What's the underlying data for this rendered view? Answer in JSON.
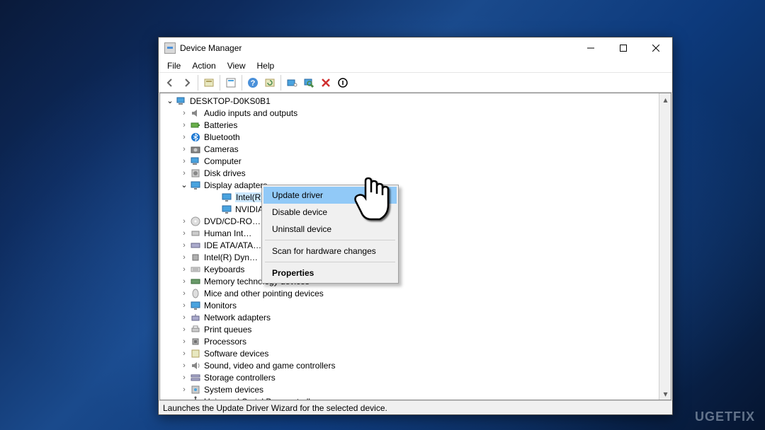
{
  "window": {
    "title": "Device Manager"
  },
  "menu": {
    "file": "File",
    "action": "Action",
    "view": "View",
    "help": "Help"
  },
  "toolbar_icons": {
    "back": "back-arrow",
    "forward": "forward-arrow",
    "show_hidden": "show-hidden",
    "properties": "properties",
    "help": "help",
    "refresh": "refresh",
    "update": "update-driver",
    "scan": "scan-hardware",
    "uninstall": "uninstall",
    "disable": "disable"
  },
  "tree": {
    "root": "DESKTOP-D0KS0B1",
    "items": [
      {
        "label": "Audio inputs and outputs",
        "icon": "speaker"
      },
      {
        "label": "Batteries",
        "icon": "battery"
      },
      {
        "label": "Bluetooth",
        "icon": "bluetooth"
      },
      {
        "label": "Cameras",
        "icon": "camera"
      },
      {
        "label": "Computer",
        "icon": "computer"
      },
      {
        "label": "Disk drives",
        "icon": "disk"
      },
      {
        "label": "Display adapters",
        "icon": "monitor",
        "expanded": true,
        "children": [
          {
            "label": "Intel(R) HD Graphics 4000",
            "icon": "monitor",
            "selected": true
          },
          {
            "label": "NVIDIA …",
            "icon": "monitor"
          }
        ]
      },
      {
        "label": "DVD/CD-RO…",
        "icon": "dvd"
      },
      {
        "label": "Human Int…",
        "icon": "hid"
      },
      {
        "label": "IDE ATA/ATA…",
        "icon": "ide"
      },
      {
        "label": "Intel(R) Dyn…",
        "icon": "chip"
      },
      {
        "label": "Keyboards",
        "icon": "keyboard"
      },
      {
        "label": "Memory technology devices",
        "icon": "memory"
      },
      {
        "label": "Mice and other pointing devices",
        "icon": "mouse"
      },
      {
        "label": "Monitors",
        "icon": "monitor"
      },
      {
        "label": "Network adapters",
        "icon": "network"
      },
      {
        "label": "Print queues",
        "icon": "printer"
      },
      {
        "label": "Processors",
        "icon": "cpu"
      },
      {
        "label": "Software devices",
        "icon": "software"
      },
      {
        "label": "Sound, video and game controllers",
        "icon": "sound"
      },
      {
        "label": "Storage controllers",
        "icon": "storage"
      },
      {
        "label": "System devices",
        "icon": "system"
      },
      {
        "label": "Universal Serial Bus controllers",
        "icon": "usb"
      }
    ]
  },
  "context_menu": {
    "items": [
      {
        "label": "Update driver",
        "highlighted": true
      },
      {
        "label": "Disable device"
      },
      {
        "label": "Uninstall device"
      },
      {
        "sep": true
      },
      {
        "label": "Scan for hardware changes"
      },
      {
        "sep": true
      },
      {
        "label": "Properties",
        "bold": true
      }
    ]
  },
  "statusbar": "Launches the Update Driver Wizard for the selected device.",
  "watermark": "UGETFIX"
}
